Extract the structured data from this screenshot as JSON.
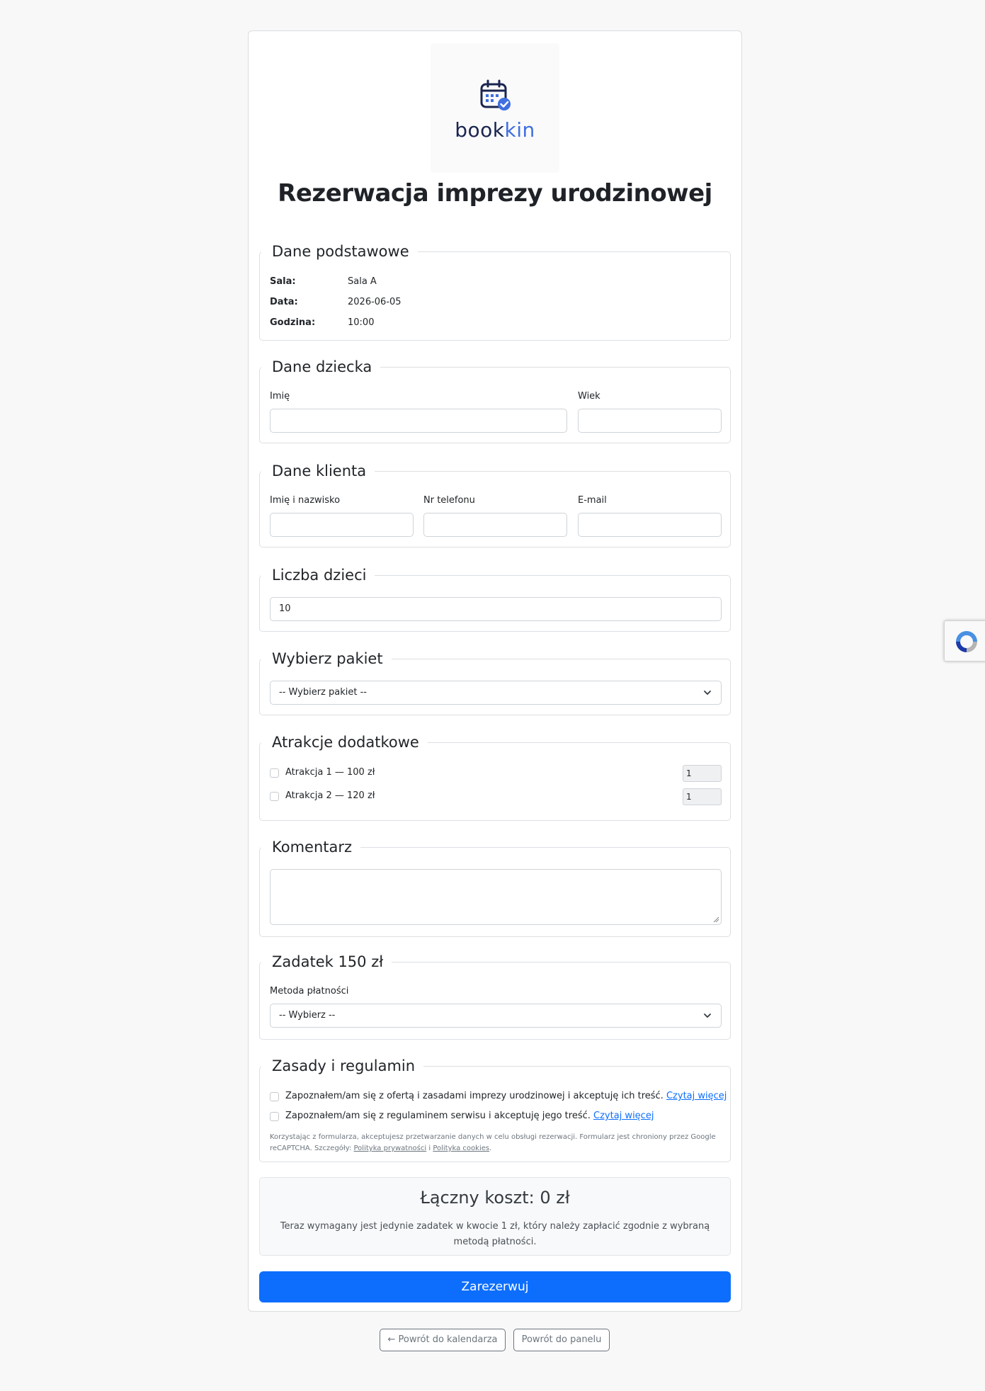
{
  "logo": {
    "part1": "book",
    "part2": "kin"
  },
  "title": "Rezerwacja imprezy urodzinowej",
  "basic": {
    "legend": "Dane podstawowe",
    "rows": [
      {
        "label": "Sala:",
        "value": "Sala A"
      },
      {
        "label": "Data:",
        "value": "2026-06-05"
      },
      {
        "label": "Godzina:",
        "value": "10:00"
      }
    ]
  },
  "child": {
    "legend": "Dane dziecka",
    "name_label": "Imię",
    "age_label": "Wiek",
    "name_value": "",
    "age_value": ""
  },
  "client": {
    "legend": "Dane klienta",
    "name_label": "Imię i nazwisko",
    "phone_label": "Nr telefonu",
    "email_label": "E-mail"
  },
  "kids": {
    "legend": "Liczba dzieci",
    "value": "10"
  },
  "package": {
    "legend": "Wybierz pakiet",
    "selected": "-- Wybierz pakiet --"
  },
  "extras": {
    "legend": "Atrakcje dodatkowe",
    "items": [
      {
        "label": "Atrakcja 1 — 100 zł",
        "qty": "1"
      },
      {
        "label": "Atrakcja 2 — 120 zł",
        "qty": "1"
      }
    ]
  },
  "comment": {
    "legend": "Komentarz",
    "value": ""
  },
  "deposit": {
    "legend": "Zadatek 150 zł",
    "method_label": "Metoda płatności",
    "selected": "-- Wybierz --"
  },
  "rules": {
    "legend": "Zasady i regulamin",
    "check1": "Zapoznałem/am się z ofertą i zasadami imprezy urodzinowej i akceptuję ich treść.",
    "check2": "Zapoznałem/am się z regulaminem serwisu i akceptuję jego treść.",
    "read_more": "Czytaj więcej",
    "notice_line1": "Korzystając z formularza, akceptujesz przetwarzanie danych w celu obsługi rezerwacji. Formularz jest chroniony przez Google",
    "notice_line2": "reCAPTCHA. Szczegóły:",
    "privacy": "Polityka prywatności",
    "and": "i",
    "cookies": "Polityka cookies",
    "period": "."
  },
  "summary": {
    "title": "Łączny koszt: 0 zł",
    "text": "Teraz wymagany jest jedynie zadatek w kwocie 1 zł, który należy zapłacić zgodnie z wybraną metodą płatności."
  },
  "submit_label": "Zarezerwuj",
  "nav": {
    "back_calendar": "← Powrót do kalendarza",
    "back_panel": "Powrót do panelu"
  },
  "colors": {
    "primary": "#0d6efd",
    "logo_dark": "#1a2550",
    "logo_blue": "#3f6fe0"
  },
  "icons": {
    "logo": "calendar-check-icon",
    "select": "chevron-down-icon",
    "recaptcha": "recaptcha-icon"
  }
}
